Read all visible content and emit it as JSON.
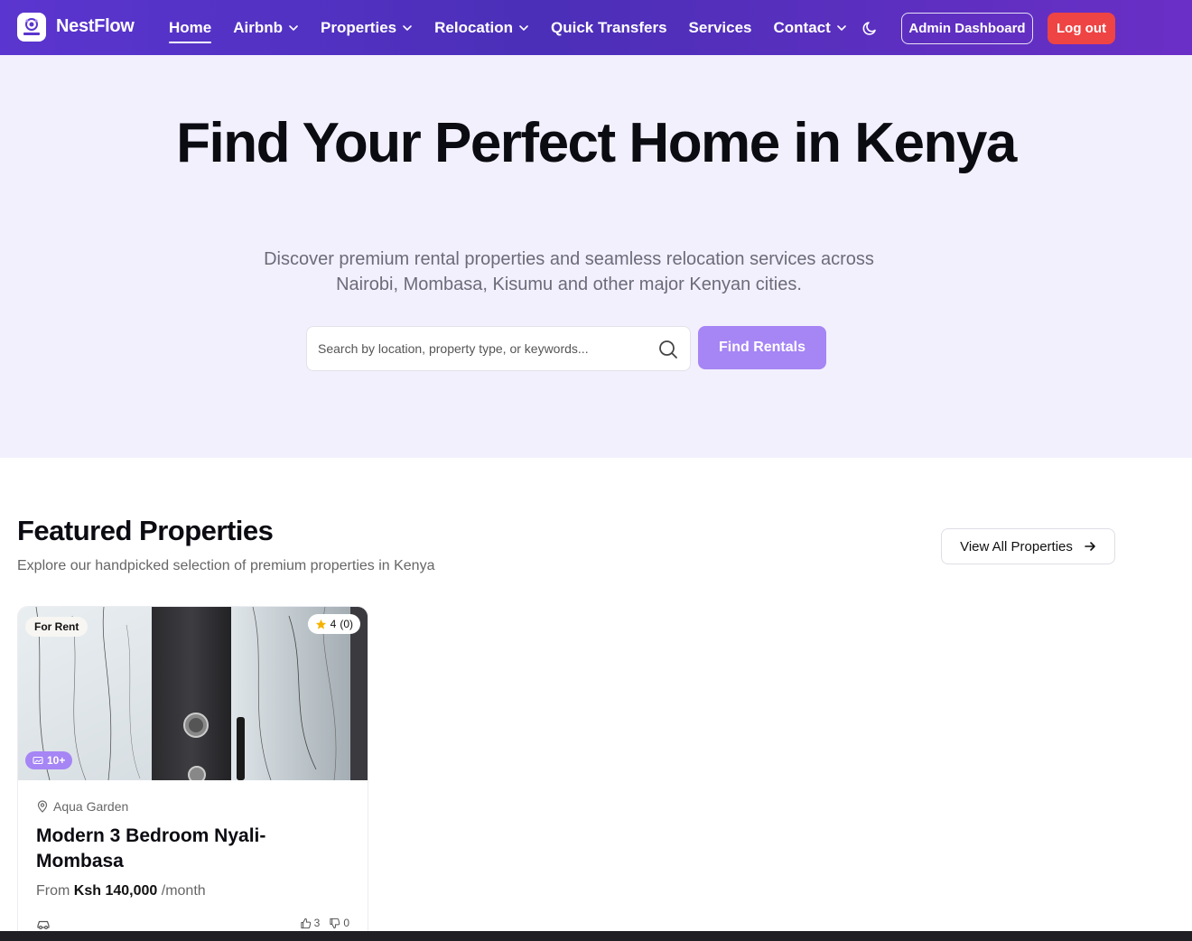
{
  "nav": {
    "brand": "NestFlow",
    "logo_text": "NestFlow",
    "links": [
      {
        "label": "Home",
        "active": true,
        "dropdown": false
      },
      {
        "label": "Airbnb",
        "dropdown": true
      },
      {
        "label": "Properties",
        "dropdown": true
      },
      {
        "label": "Relocation",
        "dropdown": true
      },
      {
        "label": "Quick Transfers",
        "dropdown": false
      },
      {
        "label": "Services",
        "dropdown": false
      },
      {
        "label": "Contact",
        "dropdown": true
      }
    ],
    "theme_icon": "moon-icon",
    "admin_label": "Admin Dashboard",
    "logout_label": "Log out"
  },
  "hero": {
    "title": "Find Your Perfect Home in Kenya",
    "subtitle": "Discover premium rental properties and seamless relocation services across Nairobi, Mombasa, Kisumu and other major Kenyan cities.",
    "search_placeholder": "Search by location, property type, or keywords...",
    "search_value": "",
    "button_label": "Find Rentals"
  },
  "featured": {
    "title": "Featured Properties",
    "subtitle": "Explore our handpicked selection of premium properties in Kenya",
    "view_all_label": "View All Properties"
  },
  "card": {
    "status_badge": "For Rent",
    "rating": "4",
    "rating_count": "(0)",
    "photos_badge": "10+",
    "location": "Aqua Garden",
    "title": "Modern 3 Bedroom Nyali-Mombasa",
    "price_prefix": "From",
    "price": "Ksh 140,000",
    "price_suffix": "/month",
    "likes": "3",
    "dislikes": "0"
  },
  "colors": {
    "nav_gradient_start": "#5b35cf",
    "nav_gradient_end": "#6a2fc6",
    "hero_bg": "#f3f0fd",
    "accent": "#a685f5",
    "logout": "#ef4444",
    "star": "#f5b301"
  }
}
